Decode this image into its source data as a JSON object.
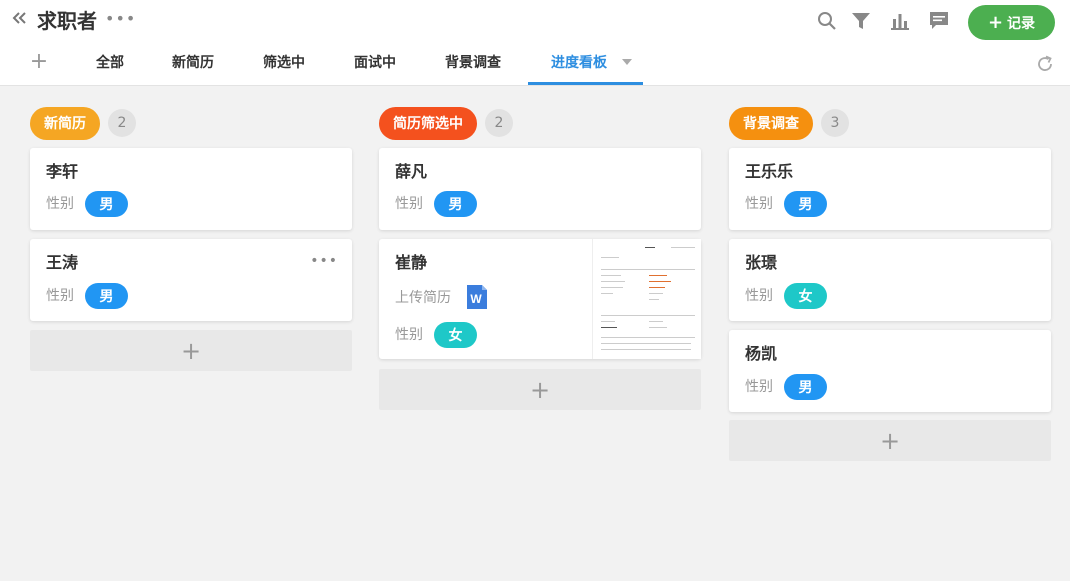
{
  "header": {
    "title": "求职者",
    "more": "•••",
    "record_label": "记录",
    "record_plus": "+"
  },
  "icons": {
    "back": "double-chevron-left",
    "search": "search",
    "filter": "filter",
    "chart": "bar-chart",
    "comment": "comment",
    "refresh": "refresh",
    "add_tab": "plus"
  },
  "tabs": [
    {
      "label": "全部"
    },
    {
      "label": "新简历"
    },
    {
      "label": "筛选中"
    },
    {
      "label": "面试中"
    },
    {
      "label": "背景调查"
    },
    {
      "label": "进度看板",
      "active": true
    }
  ],
  "columns": [
    {
      "title": "新简历",
      "count": "2",
      "color": "#f5a623",
      "cards": [
        {
          "name": "李轩",
          "gender_label": "性别",
          "gender": "男"
        },
        {
          "name": "王涛",
          "gender_label": "性别",
          "gender": "男",
          "has_more": true
        }
      ]
    },
    {
      "title": "简历筛选中",
      "count": "2",
      "color": "#f4511e",
      "cards": [
        {
          "name": "薛凡",
          "gender_label": "性别",
          "gender": "男"
        },
        {
          "name": "崔静",
          "gender_label": "性别",
          "gender": "女",
          "resume_label": "上传简历",
          "resume_icon": "W"
        }
      ]
    },
    {
      "title": "背景调查",
      "count": "3",
      "color": "#f5900f",
      "cards": [
        {
          "name": "王乐乐",
          "gender_label": "性别",
          "gender": "男"
        },
        {
          "name": "张璟",
          "gender_label": "性别",
          "gender": "女"
        },
        {
          "name": "杨凯",
          "gender_label": "性别",
          "gender": "男"
        }
      ]
    }
  ],
  "add_card_symbol": "+",
  "colors": {
    "accent": "#2d8ee0",
    "record": "#4caf50",
    "male": "#2196f3",
    "female": "#1ec8c8"
  }
}
